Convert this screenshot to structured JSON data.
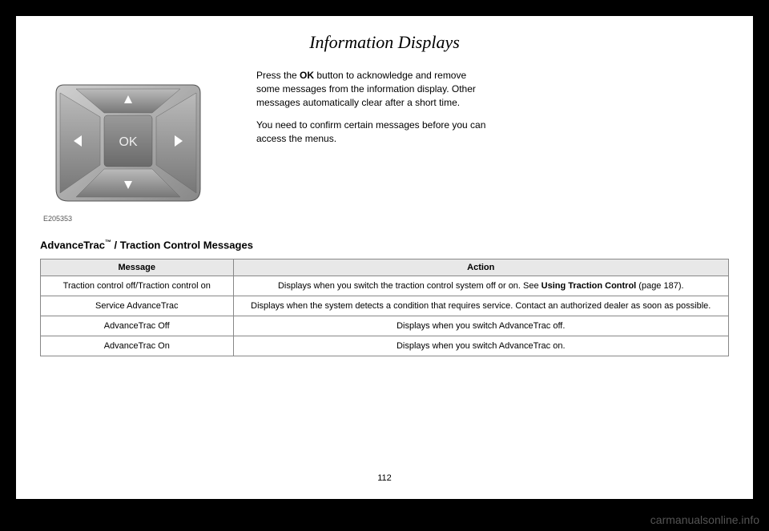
{
  "pageTitle": "Information Displays",
  "imageLabel": "E205353",
  "okButtonLabel": "OK",
  "intro": {
    "p1_before": "Press the ",
    "p1_bold": "OK",
    "p1_after": " button to acknowledge and remove some messages from the information display. Other messages automatically clear after a short time.",
    "p2": "You need to confirm certain messages before you can access the menus."
  },
  "sectionHeading": {
    "prefix": "AdvanceTrac",
    "tm": "™",
    "suffix": " / Traction Control Messages"
  },
  "table": {
    "headers": {
      "message": "Message",
      "action": "Action"
    },
    "rows": [
      {
        "message": "Traction control off/Traction control on",
        "action_before": "Displays when you switch the traction control system off or on.  See ",
        "action_bold": "Using Traction Control",
        "action_after": " (page 187)."
      },
      {
        "message": "Service AdvanceTrac",
        "action": "Displays when the system detects a condition that requires service. Contact an authorized dealer as soon as possible."
      },
      {
        "message": "AdvanceTrac Off",
        "action": "Displays when you switch AdvanceTrac off."
      },
      {
        "message": "AdvanceTrac On",
        "action": "Displays when you switch AdvanceTrac on."
      }
    ]
  },
  "pageNumber": "112",
  "watermark": "carmanualsonline.info"
}
